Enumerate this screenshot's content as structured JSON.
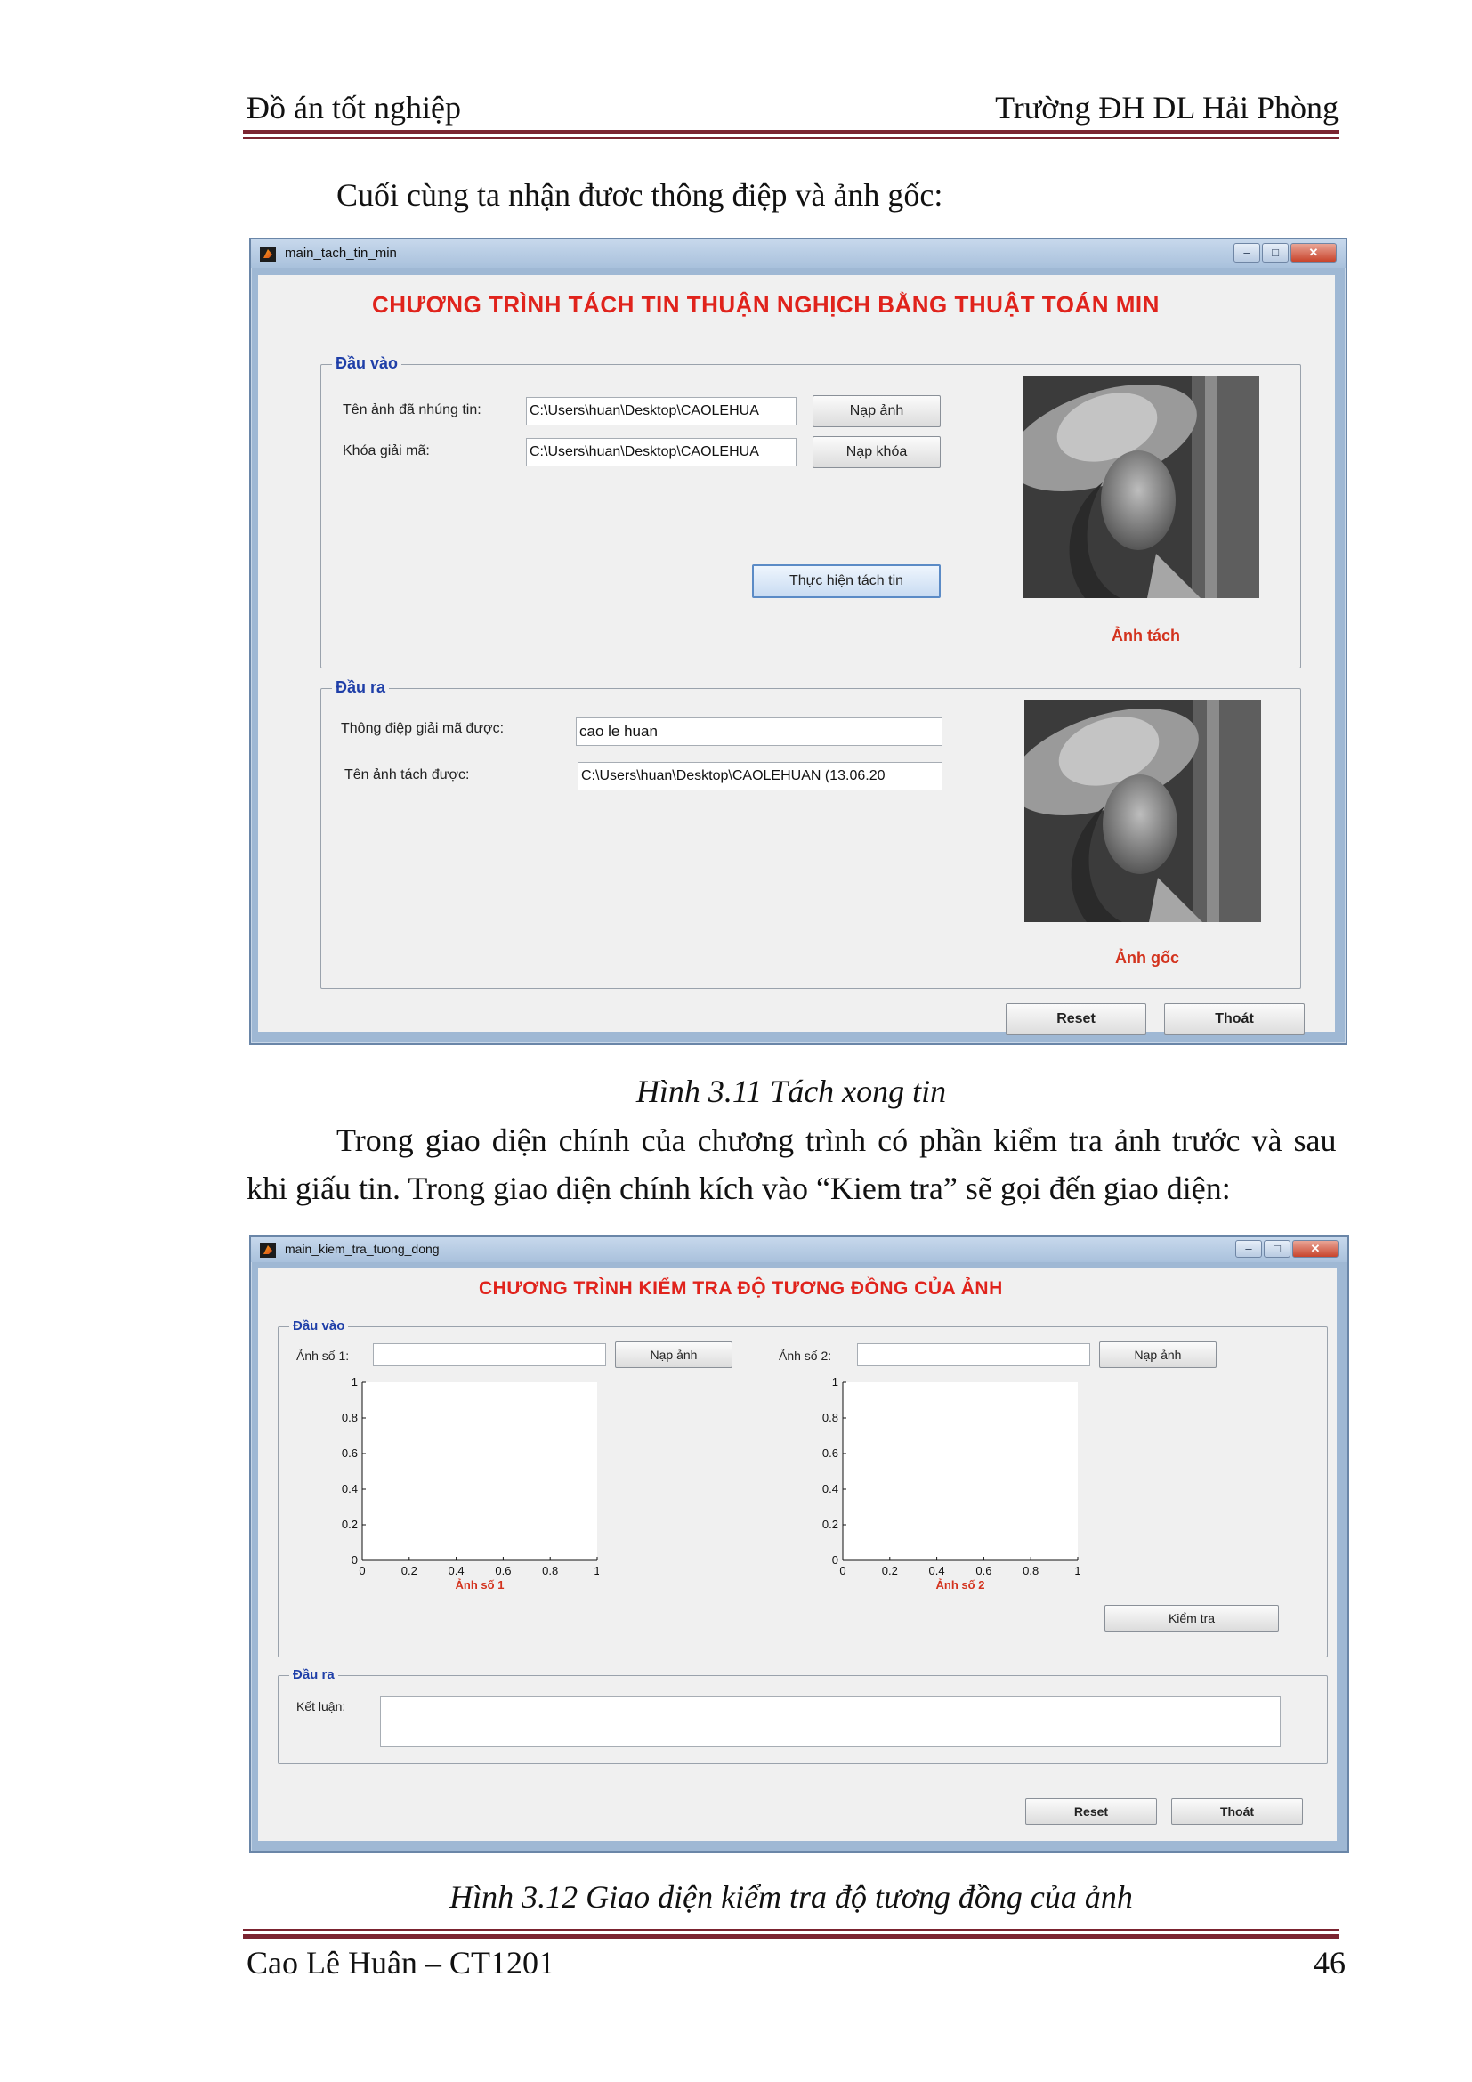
{
  "header": {
    "left": "Đồ án tốt nghiệp",
    "right": "Trường ĐH DL Hải Phòng"
  },
  "paragraphs": {
    "p1": "Cuối cùng ta nhận đươc thông điệp và ảnh gốc:",
    "p2_line1": "Trong giao diện chính của chương trình có phần kiểm tra ảnh trước và sau",
    "p2_line2": "khi giấu tin. Trong giao diện chính kích vào “Kiem tra” sẽ gọi đến giao diện:"
  },
  "window1": {
    "title": "main_tach_tin_min",
    "app_title": "CHƯƠNG TRÌNH TÁCH TIN THUẬN NGHỊCH BẰNG THUẬT TOÁN MIN",
    "input_panel": {
      "label": "Đầu vào",
      "embedded_image_label": "Tên ảnh đã nhúng tin:",
      "embedded_image_value": "C:\\Users\\huan\\Desktop\\CAOLEHUA",
      "load_image_button": "Nạp ảnh",
      "decode_key_label": "Khóa giải mã:",
      "decode_key_value": "C:\\Users\\huan\\Desktop\\CAOLEHUA",
      "load_key_button": "Nạp khóa",
      "extract_button": "Thực hiện tách tin",
      "image_caption": "Ảnh tách"
    },
    "output_panel": {
      "label": "Đầu ra",
      "message_label": "Thông điệp giải mã được:",
      "message_value": "cao le huan",
      "extracted_name_label": "Tên ảnh tách được:",
      "extracted_name_value": "C:\\Users\\huan\\Desktop\\CAOLEHUAN (13.06.20",
      "image_caption": "Ảnh gốc"
    },
    "reset_button": "Reset",
    "exit_button": "Thoát"
  },
  "caption1": "Hình 3.11 Tách xong tin",
  "window2": {
    "title": "main_kiem_tra_tuong_dong",
    "app_title": "CHƯƠNG TRÌNH KIỂM TRA ĐỘ TƯƠNG ĐỒNG CỦA ẢNH",
    "input_panel": {
      "label": "Đầu vào",
      "image1_label": "Ảnh số 1:",
      "image1_value": "",
      "image1_button": "Nạp ảnh",
      "image2_label": "Ảnh số 2:",
      "image2_value": "",
      "image2_button": "Nạp ảnh",
      "check_button": "Kiểm tra"
    },
    "output_panel": {
      "label": "Đầu ra",
      "conclusion_label": "Kết luận:",
      "conclusion_value": ""
    },
    "reset_button": "Reset",
    "exit_button": "Thoát"
  },
  "chart_data": [
    {
      "type": "scatter",
      "xlabel": "Ảnh số 1",
      "xlim": [
        0,
        1
      ],
      "ylim": [
        0,
        1
      ],
      "xticks": [
        "0",
        "0.2",
        "0.4",
        "0.6",
        "0.8",
        "1"
      ],
      "yticks": [
        "0",
        "0.2",
        "0.4",
        "0.6",
        "0.8",
        "1"
      ],
      "series": []
    },
    {
      "type": "scatter",
      "xlabel": "Ảnh số 2",
      "xlim": [
        0,
        1
      ],
      "ylim": [
        0,
        1
      ],
      "xticks": [
        "0",
        "0.2",
        "0.4",
        "0.6",
        "0.8",
        "1"
      ],
      "yticks": [
        "0",
        "0.2",
        "0.4",
        "0.6",
        "0.8",
        "1"
      ],
      "series": []
    }
  ],
  "caption2": "Hình 3.12 Giao diện kiểm tra độ tương đồng của ảnh",
  "footer": {
    "left": "Cao Lê Huân – CT1201",
    "right": "46"
  }
}
